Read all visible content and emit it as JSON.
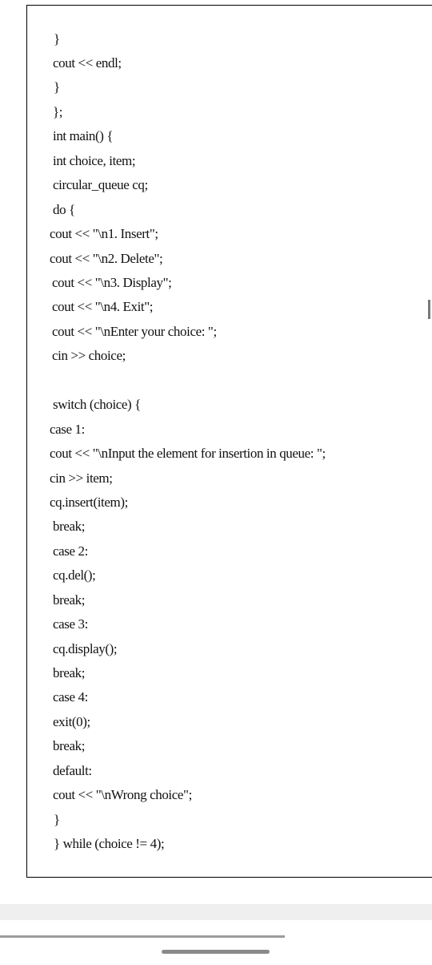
{
  "code": {
    "lines": [
      "}",
      "cout << endl;",
      "}",
      "};",
      "int main() {",
      "int choice, item;",
      "circular_queue cq;",
      "do {",
      "cout << \"\\n1. Insert\";",
      "cout << \"\\n2. Delete\";",
      "cout << \"\\n3. Display\";",
      "cout << \"\\n4. Exit\";",
      "cout << \"\\nEnter your choice: \";",
      "cin >> choice;",
      "switch (choice) {",
      "case 1:",
      "cout << \"\\nInput the element for insertion in queue: \";",
      "cin >> item;",
      "cq.insert(item);",
      "break;",
      "case 2:",
      "cq.del();",
      "break;",
      "case 3:",
      "cq.display();",
      "break;",
      "case 4:",
      "exit(0);",
      "break;",
      "default:",
      "cout << \"\\nWrong choice\";",
      "}",
      "} while (choice != 4);"
    ]
  }
}
